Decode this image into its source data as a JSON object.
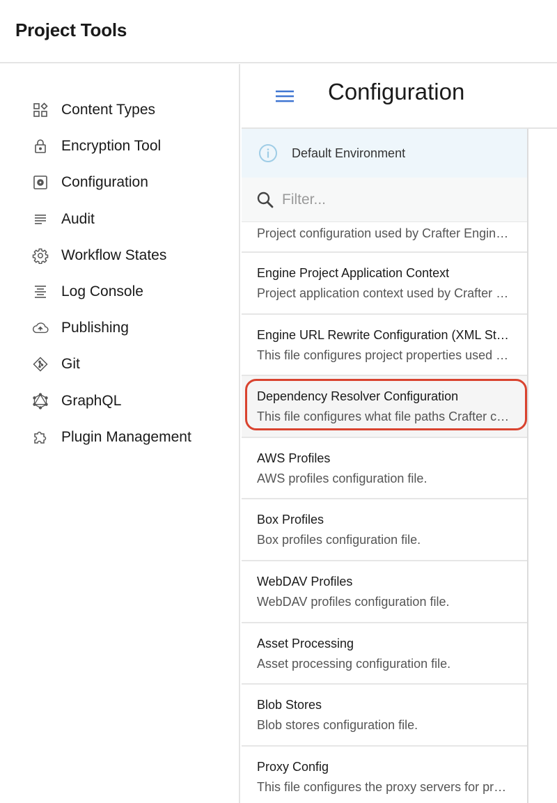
{
  "header": {
    "title": "Project Tools"
  },
  "sidebar": {
    "items": [
      {
        "label": "Content Types",
        "icon": "content-types-icon"
      },
      {
        "label": "Encryption Tool",
        "icon": "lock-icon"
      },
      {
        "label": "Configuration",
        "icon": "settings-box-icon"
      },
      {
        "label": "Audit",
        "icon": "list-icon"
      },
      {
        "label": "Workflow States",
        "icon": "gear-icon"
      },
      {
        "label": "Log Console",
        "icon": "align-center-icon"
      },
      {
        "label": "Publishing",
        "icon": "cloud-upload-icon"
      },
      {
        "label": "Git",
        "icon": "git-icon"
      },
      {
        "label": "GraphQL",
        "icon": "graphql-icon"
      },
      {
        "label": "Plugin Management",
        "icon": "puzzle-icon"
      }
    ]
  },
  "main": {
    "title": "Configuration",
    "environment": "Default Environment",
    "filter": {
      "placeholder": "Filter...",
      "value": ""
    },
    "items": [
      {
        "title": "",
        "description": "Project configuration used by Crafter Engine, overrides default values."
      },
      {
        "title": "Engine Project Application Context",
        "description": "Project application context used by Crafter Engine."
      },
      {
        "title": "Engine URL Rewrite Configuration (XML Style)",
        "description": "This file configures project properties used by Crafter Engine."
      },
      {
        "title": "Dependency Resolver Configuration",
        "description": "This file configures what file paths Crafter considers dependencies."
      },
      {
        "title": "AWS Profiles",
        "description": "AWS profiles configuration file."
      },
      {
        "title": "Box Profiles",
        "description": "Box profiles configuration file."
      },
      {
        "title": "WebDAV Profiles",
        "description": "WebDAV profiles configuration file."
      },
      {
        "title": "Asset Processing",
        "description": "Asset processing configuration file."
      },
      {
        "title": "Blob Stores",
        "description": "Blob stores configuration file."
      },
      {
        "title": "Proxy Config",
        "description": "This file configures the proxy servers for preview."
      }
    ],
    "selected_index": 3
  },
  "colors": {
    "accent_blue": "#3b73d1",
    "highlight_red": "#d9432f",
    "info_bg": "#eef6fb",
    "info_icon": "#9fcde6"
  }
}
